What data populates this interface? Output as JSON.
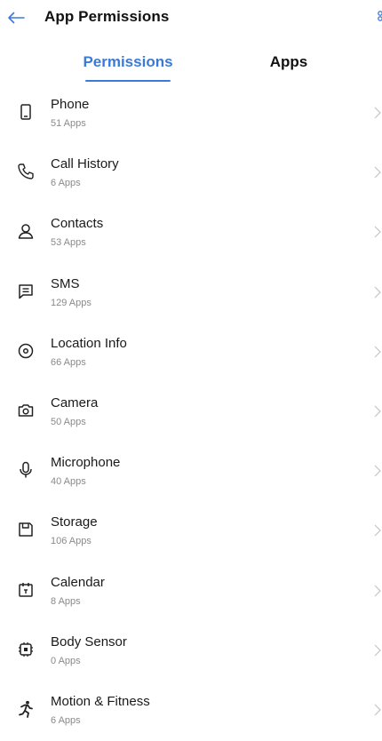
{
  "header": {
    "title": "App Permissions",
    "back_icon": "back-arrow-icon",
    "more_icon": "more-options-icon",
    "accent_color": "#3a7ad9"
  },
  "tabs": [
    {
      "label": "Permissions",
      "selected": true
    },
    {
      "label": "Apps",
      "selected": false
    }
  ],
  "permissions": [
    {
      "label": "Phone",
      "count": "51 Apps",
      "icon": "phone-icon"
    },
    {
      "label": "Call History",
      "count": "6 Apps",
      "icon": "call-history-icon"
    },
    {
      "label": "Contacts",
      "count": "53 Apps",
      "icon": "contacts-icon"
    },
    {
      "label": "SMS",
      "count": "129 Apps",
      "icon": "sms-icon"
    },
    {
      "label": "Location Info",
      "count": "66 Apps",
      "icon": "location-icon"
    },
    {
      "label": "Camera",
      "count": "50 Apps",
      "icon": "camera-icon"
    },
    {
      "label": "Microphone",
      "count": "40 Apps",
      "icon": "microphone-icon"
    },
    {
      "label": "Storage",
      "count": "106 Apps",
      "icon": "storage-icon"
    },
    {
      "label": "Calendar",
      "count": "8 Apps",
      "icon": "calendar-icon"
    },
    {
      "label": "Body Sensor",
      "count": "0 Apps",
      "icon": "body-sensor-icon"
    },
    {
      "label": "Motion & Fitness",
      "count": "6 Apps",
      "icon": "motion-fitness-icon"
    }
  ]
}
